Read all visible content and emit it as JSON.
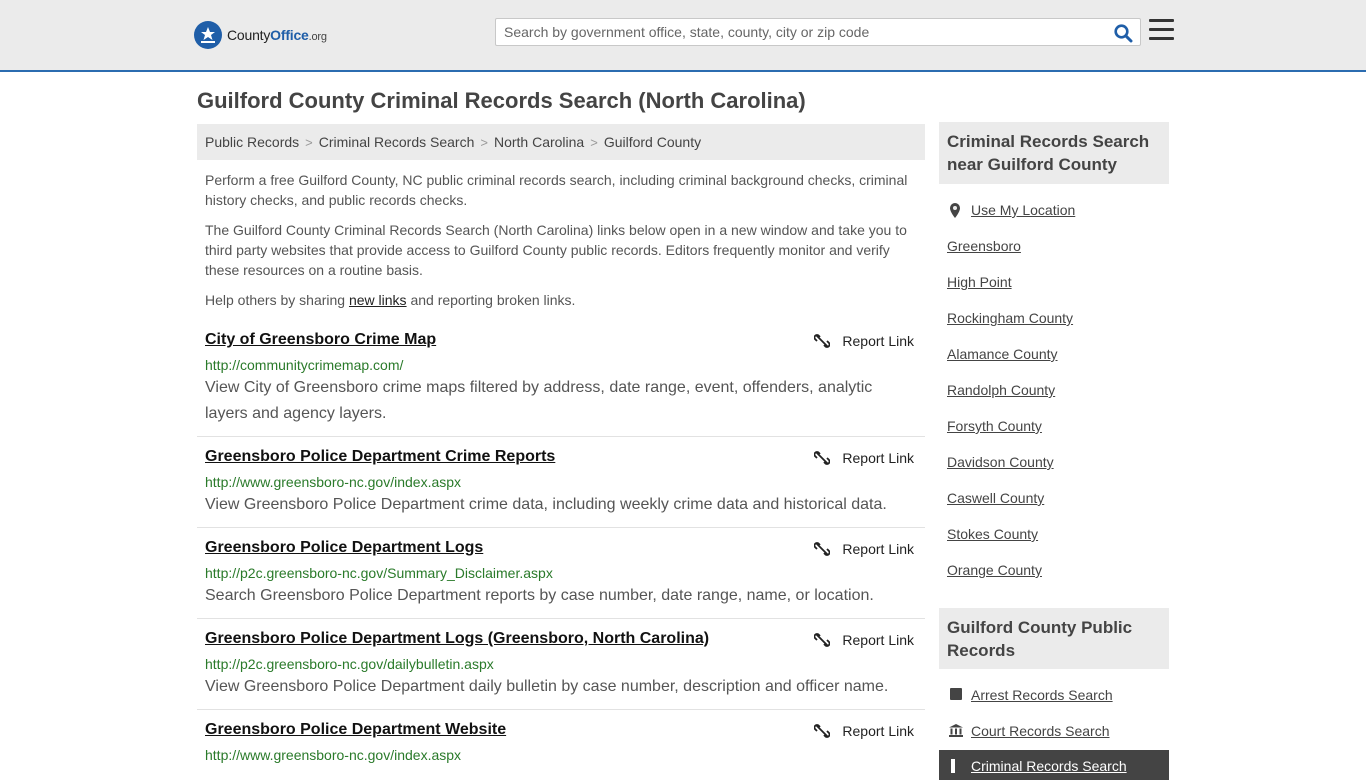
{
  "header": {
    "logo_county": "County",
    "logo_office": "Office",
    "logo_org": ".org",
    "search_placeholder": "Search by government office, state, county, city or zip code"
  },
  "page_title": "Guilford County Criminal Records Search (North Carolina)",
  "breadcrumb": [
    {
      "label": "Public Records"
    },
    {
      "label": "Criminal Records Search"
    },
    {
      "label": "North Carolina"
    },
    {
      "label": "Guilford County"
    }
  ],
  "intro": {
    "p1": "Perform a free Guilford County, NC public criminal records search, including criminal background checks, criminal history checks, and public records checks.",
    "p2": "The Guilford County Criminal Records Search (North Carolina) links below open in a new window and take you to third party websites that provide access to Guilford County public records. Editors frequently monitor and verify these resources on a routine basis.",
    "p3_before": "Help others by sharing ",
    "p3_link": "new links",
    "p3_after": " and reporting broken links."
  },
  "report_label": "Report Link",
  "results": [
    {
      "title": "City of Greensboro Crime Map",
      "url": "http://communitycrimemap.com/",
      "desc": "View City of Greensboro crime maps filtered by address, date range, event, offenders, analytic layers and agency layers."
    },
    {
      "title": "Greensboro Police Department Crime Reports",
      "url": "http://www.greensboro-nc.gov/index.aspx",
      "desc": "View Greensboro Police Department crime data, including weekly crime data and historical data."
    },
    {
      "title": "Greensboro Police Department Logs",
      "url": "http://p2c.greensboro-nc.gov/Summary_Disclaimer.aspx",
      "desc": "Search Greensboro Police Department reports by case number, date range, name, or location."
    },
    {
      "title": "Greensboro Police Department Logs (Greensboro, North Carolina)",
      "url": "http://p2c.greensboro-nc.gov/dailybulletin.aspx",
      "desc": "View Greensboro Police Department daily bulletin by case number, description and officer name."
    },
    {
      "title": "Greensboro Police Department Website",
      "url": "http://www.greensboro-nc.gov/index.aspx",
      "desc": ""
    }
  ],
  "sidebar": {
    "nearby_title": "Criminal Records Search near Guilford County",
    "use_location": "Use My Location",
    "nearby": [
      "Greensboro",
      "High Point",
      "Rockingham County",
      "Alamance County",
      "Randolph County",
      "Forsyth County",
      "Davidson County",
      "Caswell County",
      "Stokes County",
      "Orange County"
    ],
    "public_title": "Guilford County Public Records",
    "public": [
      {
        "label": "Arrest Records Search",
        "icon": "square-icon"
      },
      {
        "label": "Court Records Search",
        "icon": "courthouse-icon"
      },
      {
        "label": "Criminal Records Search",
        "icon": "gavel-icon"
      }
    ]
  },
  "colors": {
    "header_bg": "#ebebeb",
    "accent_blue": "#1f5ea8",
    "url_green": "#2a7a2a",
    "active_bg": "#444444"
  }
}
